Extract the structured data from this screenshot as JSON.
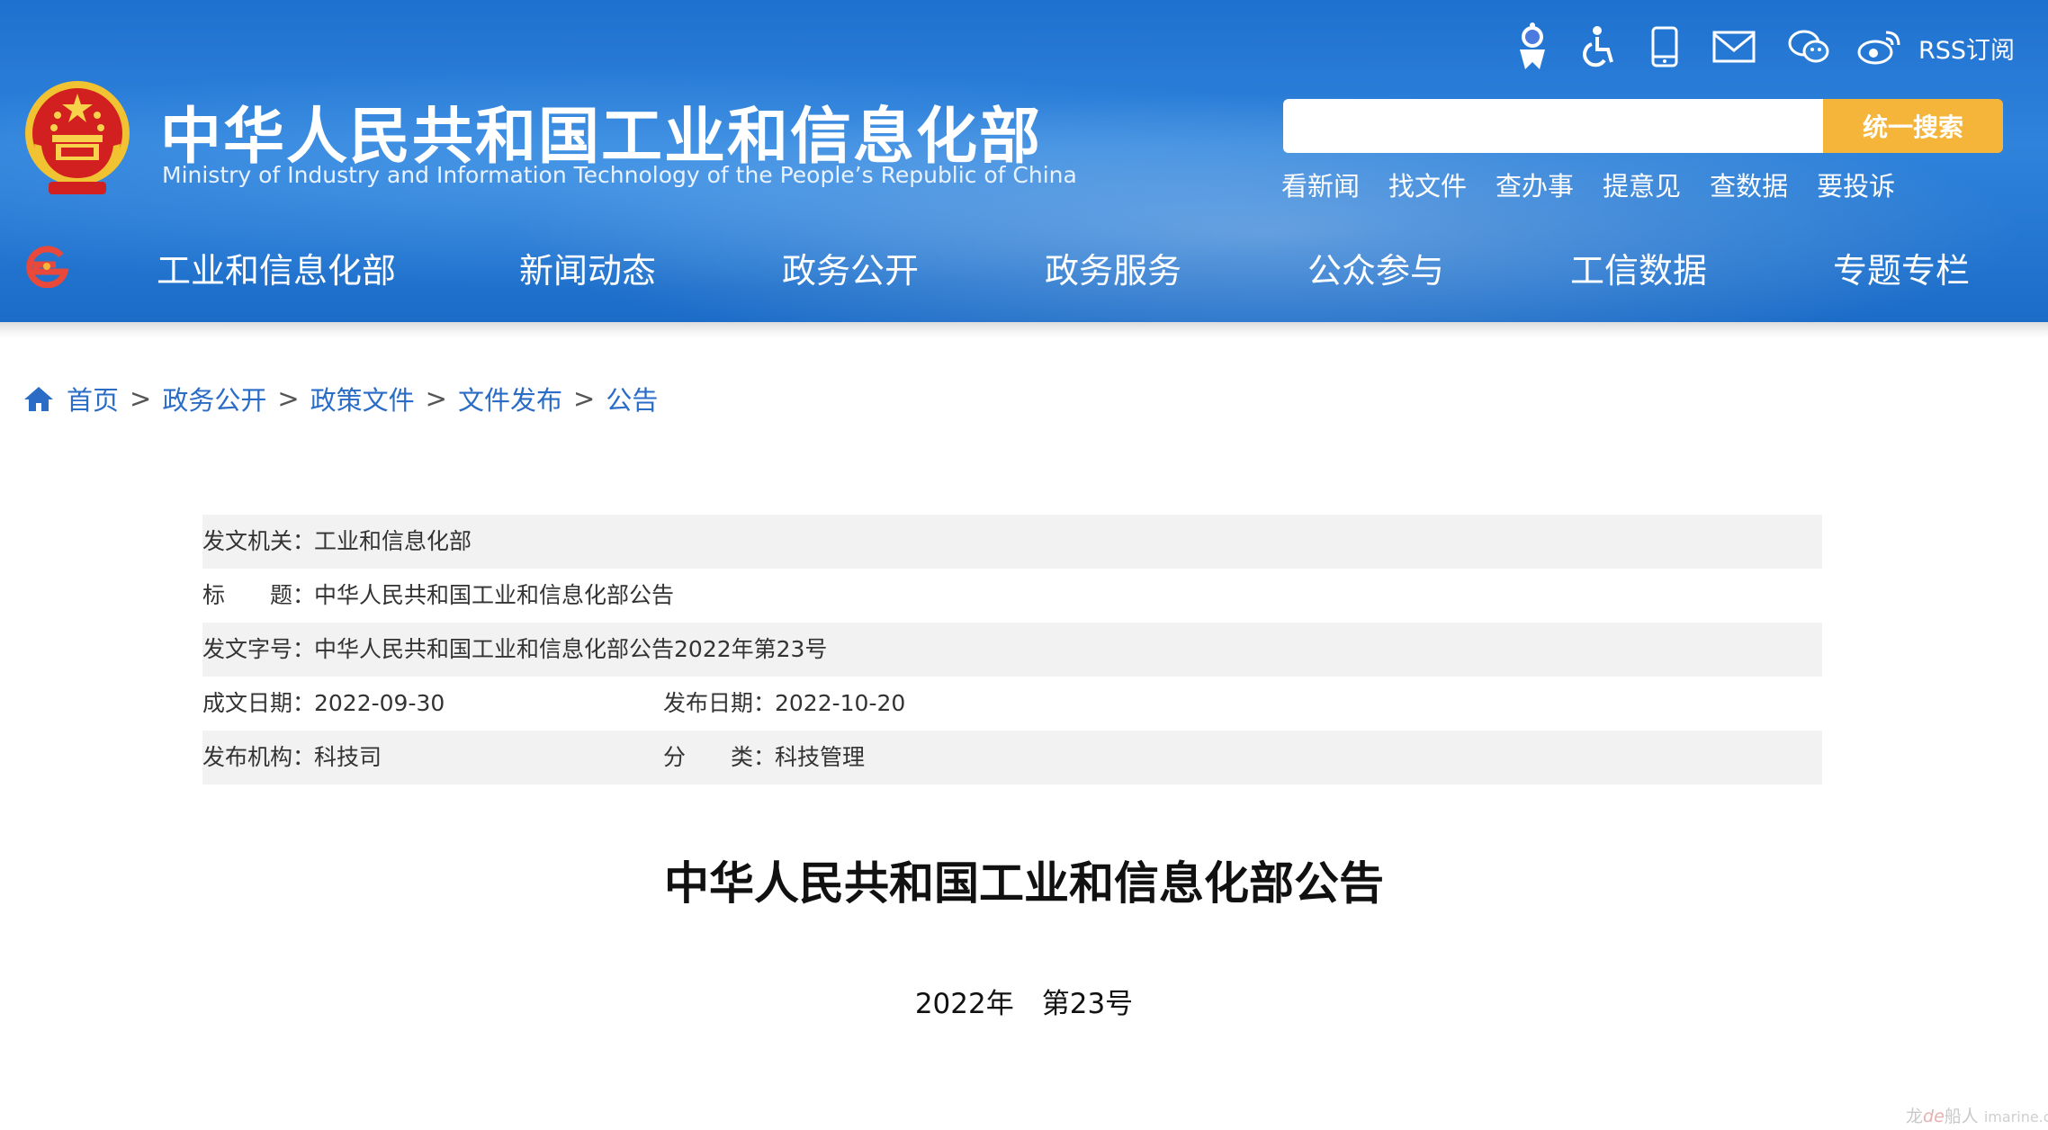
{
  "header": {
    "title_cn": "中华人民共和国工业和信息化部",
    "title_en": "Ministry of Industry and Information Technology of the People’s Republic of China",
    "utility_icons": [
      "robot-assistant-icon",
      "accessibility-icon",
      "mobile-icon",
      "mail-icon",
      "wechat-icon",
      "weibo-icon"
    ],
    "rss_label": "RSS订阅",
    "search": {
      "value": "",
      "placeholder": "",
      "button_label": "统一搜索"
    },
    "quick_links": [
      "看新闻",
      "找文件",
      "查办事",
      "提意见",
      "查数据",
      "要投诉"
    ]
  },
  "nav": {
    "items": [
      "工业和信息化部",
      "新闻动态",
      "政务公开",
      "政务服务",
      "公众参与",
      "工信数据",
      "专题专栏"
    ]
  },
  "breadcrumb": {
    "items": [
      "首页",
      "政务公开",
      "政策文件",
      "文件发布",
      "公告"
    ],
    "separator": ">"
  },
  "meta": {
    "issuer_label": "发文机关：",
    "issuer": "工业和信息化部",
    "title_label": "标　　题：",
    "title": "中华人民共和国工业和信息化部公告",
    "doc_no_label": "发文字号：",
    "doc_no": "中华人民共和国工业和信息化部公告2022年第23号",
    "written_label": "成文日期：",
    "written": "2022-09-30",
    "published_label": "发布日期：",
    "published": "2022-10-20",
    "org_label": "发布机构：",
    "org": "科技司",
    "category_label": "分　　类：",
    "category": "科技管理"
  },
  "document": {
    "title": "中华人民共和国工业和信息化部公告",
    "number": "2022年　第23号"
  },
  "watermark": {
    "cn": "龙",
    "de": "de",
    "cn2": "船人",
    "domain": "imarine.cn"
  },
  "colors": {
    "header_blue": "#2a7bd6",
    "search_button": "#f4b53a",
    "link_blue": "#2a6cc6",
    "row_shade": "#f2f2f2"
  }
}
